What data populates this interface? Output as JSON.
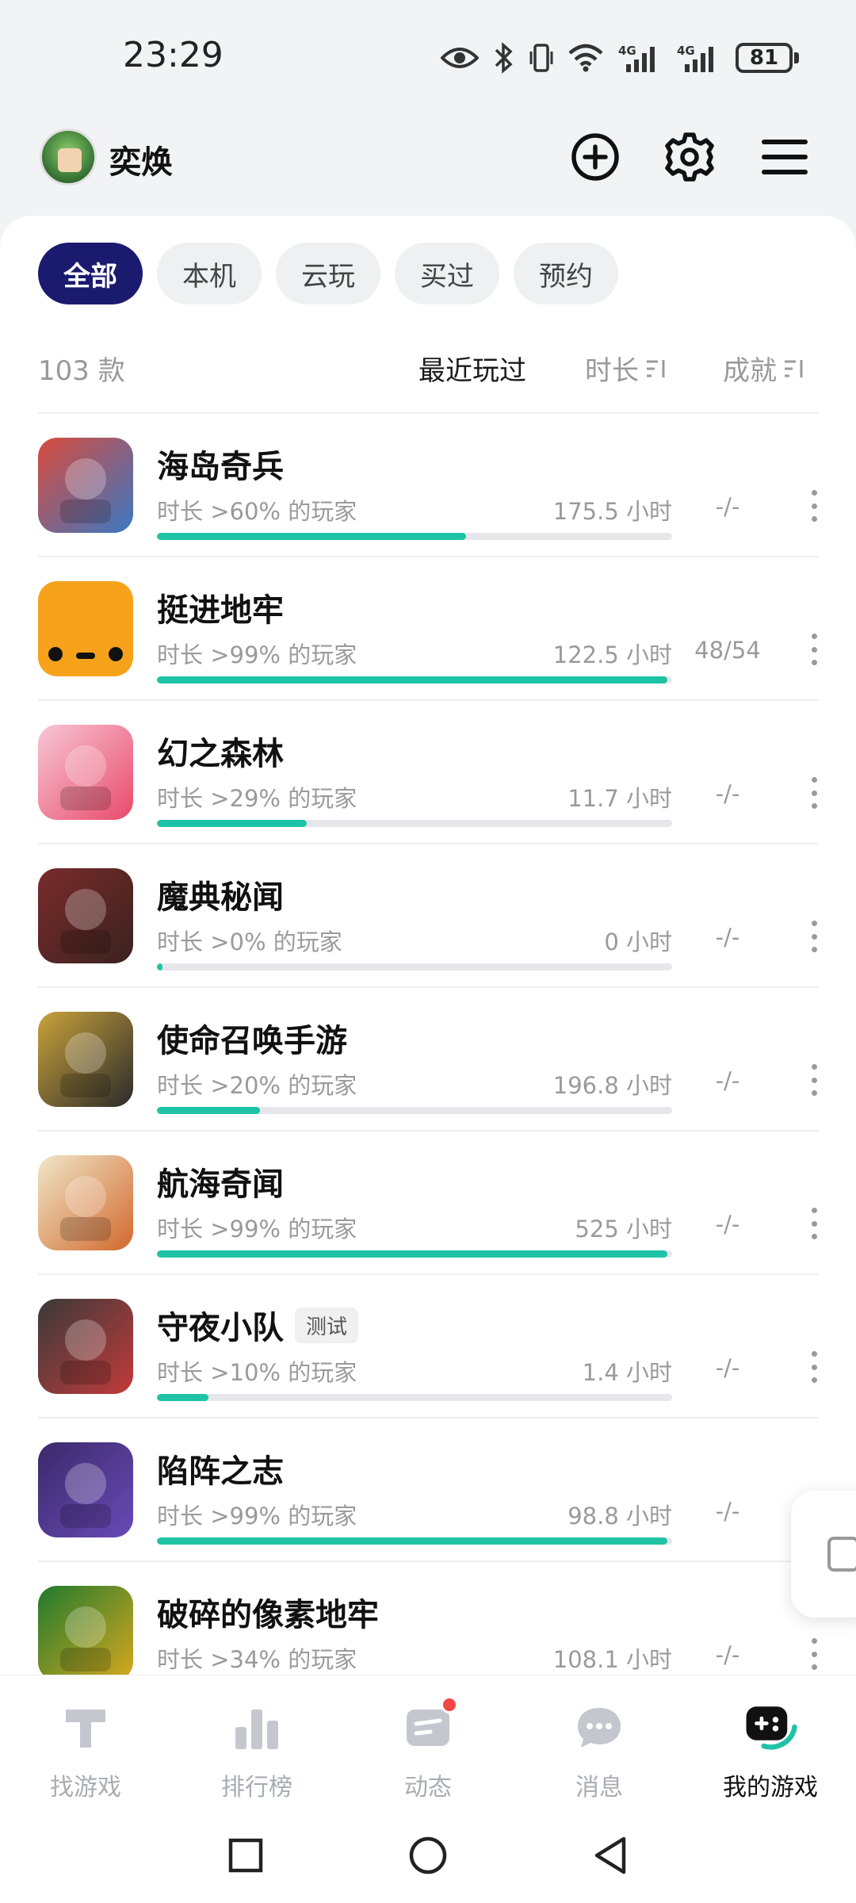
{
  "status_bar": {
    "time": "23:29",
    "battery": "81",
    "icons": [
      "eye-icon",
      "bluetooth-icon",
      "vibrate-icon",
      "wifi-icon",
      "4g-signal-icon",
      "4g-signal-icon"
    ]
  },
  "header": {
    "username": "奕焕",
    "actions": [
      "add-circle-icon",
      "gear-icon",
      "menu-icon"
    ]
  },
  "tabs": [
    {
      "label": "全部",
      "active": true
    },
    {
      "label": "本机",
      "active": false
    },
    {
      "label": "云玩",
      "active": false
    },
    {
      "label": "买过",
      "active": false
    },
    {
      "label": "预约",
      "active": false
    }
  ],
  "sort_bar": {
    "count": "103 款",
    "recent": "最近玩过",
    "duration": "时长",
    "achievement": "成就"
  },
  "games": [
    {
      "name": "海岛奇兵",
      "tag": "",
      "percent_label": "时长 >60% 的玩家",
      "hours": "175.5 小时",
      "achievement": "-/-",
      "progress": 0.6,
      "colors": [
        "#d94a3a",
        "#3b78c4"
      ]
    },
    {
      "name": "挺进地牢",
      "tag": "",
      "percent_label": "时长 >99% 的玩家",
      "hours": "122.5 小时",
      "achievement": "48/54",
      "progress": 0.99,
      "colors": [
        "#f7a21b",
        "#f7a21b"
      ]
    },
    {
      "name": "幻之森林",
      "tag": "",
      "percent_label": "时长 >29% 的玩家",
      "hours": "11.7 小时",
      "achievement": "-/-",
      "progress": 0.29,
      "colors": [
        "#f7c6d6",
        "#e94a6a"
      ]
    },
    {
      "name": "魔典秘闻",
      "tag": "",
      "percent_label": "时长 >0% 的玩家",
      "hours": "0 小时",
      "achievement": "-/-",
      "progress": 0.01,
      "colors": [
        "#7a2b2b",
        "#3a2220"
      ]
    },
    {
      "name": "使命召唤手游",
      "tag": "",
      "percent_label": "时长 >20% 的玩家",
      "hours": "196.8 小时",
      "achievement": "-/-",
      "progress": 0.2,
      "colors": [
        "#c9a23a",
        "#2b2b2b"
      ]
    },
    {
      "name": "航海奇闻",
      "tag": "",
      "percent_label": "时长 >99% 的玩家",
      "hours": "525 小时",
      "achievement": "-/-",
      "progress": 0.99,
      "colors": [
        "#f0e6c8",
        "#d2692e"
      ]
    },
    {
      "name": "守夜小队",
      "tag": "测试",
      "percent_label": "时长 >10% 的玩家",
      "hours": "1.4 小时",
      "achievement": "-/-",
      "progress": 0.1,
      "colors": [
        "#3a3a3a",
        "#c23a3a"
      ]
    },
    {
      "name": "陷阵之志",
      "tag": "",
      "percent_label": "时长 >99% 的玩家",
      "hours": "98.8 小时",
      "achievement": "-/-",
      "progress": 0.99,
      "colors": [
        "#3a2a6a",
        "#6a4ab8"
      ]
    },
    {
      "name": "破碎的像素地牢",
      "tag": "",
      "percent_label": "时长 >34% 的玩家",
      "hours": "108.1 小时",
      "achievement": "-/-",
      "progress": 0.34,
      "colors": [
        "#1f7a2e",
        "#d8a81e"
      ]
    }
  ],
  "bottom_nav": [
    {
      "label": "找游戏",
      "icon": "find-games-icon",
      "active": false
    },
    {
      "label": "排行榜",
      "icon": "leaderboard-icon",
      "active": false
    },
    {
      "label": "动态",
      "icon": "feed-icon",
      "active": false,
      "badge": true
    },
    {
      "label": "消息",
      "icon": "message-icon",
      "active": false
    },
    {
      "label": "我的游戏",
      "icon": "gamepad-icon",
      "active": true
    }
  ],
  "colors": {
    "accent": "#1a1a6e",
    "progress": "#1ec3a5",
    "muted": "#9a9a9a",
    "badge": "#f24646"
  }
}
